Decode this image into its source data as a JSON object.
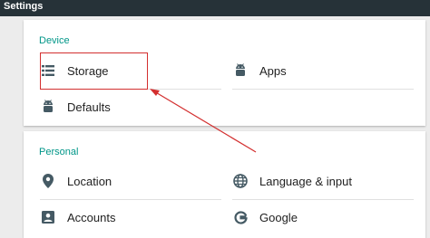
{
  "window": {
    "title": "Settings"
  },
  "device": {
    "header": "Device",
    "items": [
      {
        "label": "Storage",
        "icon": "storage-icon"
      },
      {
        "label": "Apps",
        "icon": "android-icon"
      },
      {
        "label": "Defaults",
        "icon": "android-icon"
      }
    ]
  },
  "personal": {
    "header": "Personal",
    "items": [
      {
        "label": "Location",
        "icon": "location-pin-icon"
      },
      {
        "label": "Language & input",
        "icon": "globe-icon"
      },
      {
        "label": "Accounts",
        "icon": "account-box-icon"
      },
      {
        "label": "Google",
        "icon": "google-icon"
      }
    ]
  },
  "colors": {
    "accent": "#009688",
    "titlebar": "#263238",
    "annotation": "#d32f2f",
    "icon": "#455a64"
  }
}
